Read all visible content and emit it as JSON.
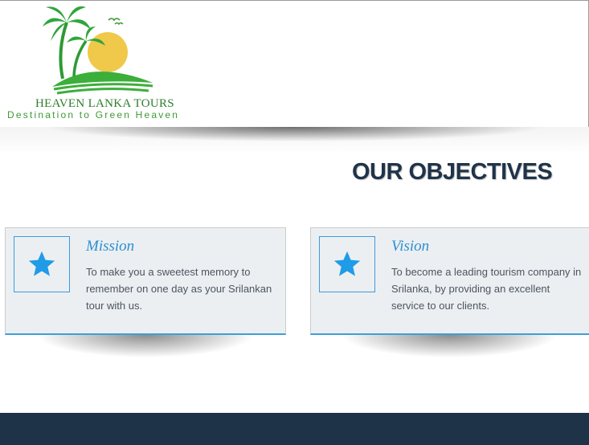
{
  "header": {
    "brand_name": "HEAVEN LANKA TOURS",
    "tagline": "Destination to Green Heaven"
  },
  "objectives": {
    "title": "OUR OBJECTIVES",
    "cards": [
      {
        "icon": "star-icon",
        "title": "Mission",
        "text": "To make you a sweetest memory to remember on one day as your Srilankan tour with us."
      },
      {
        "icon": "star-icon",
        "title": "Vision",
        "text": "To become a leading tourism company in Srilanka, by providing an excellent service to our clients."
      }
    ]
  },
  "colors": {
    "accent": "#2b8fd1",
    "heading": "#1f3349",
    "footer": "#1e3248",
    "brand_green": "#3c9a33",
    "sun": "#f0c94a"
  }
}
